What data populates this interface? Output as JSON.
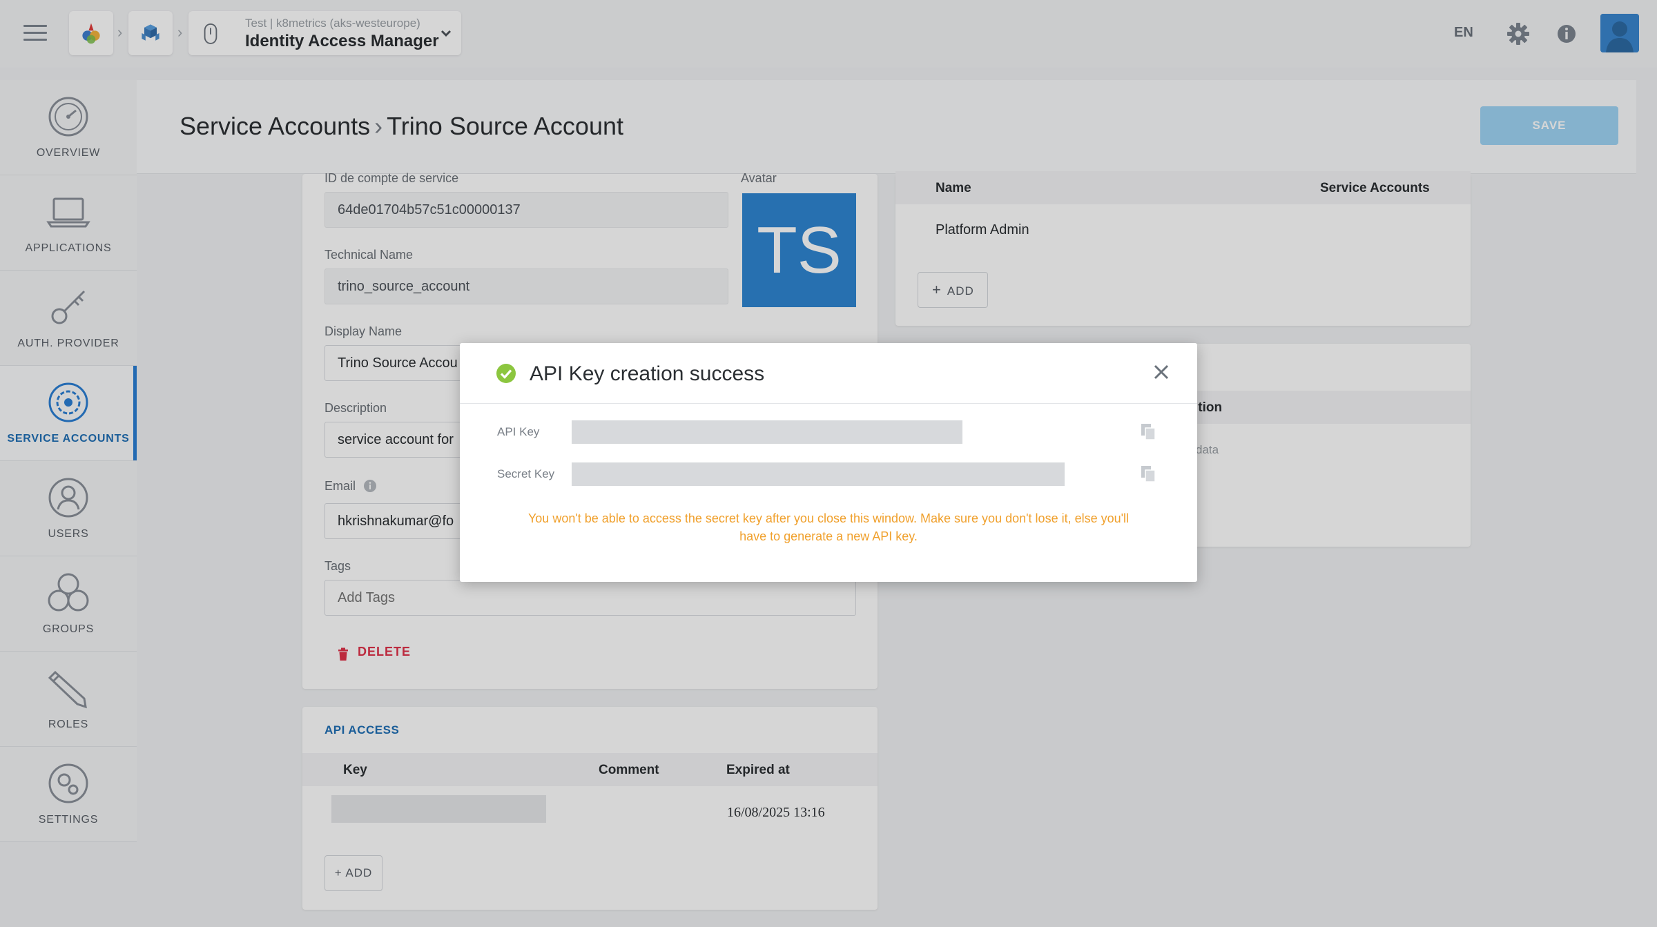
{
  "topbar": {
    "app_subtitle": "Test | k8metrics (aks-westeurope)",
    "app_title": "Identity Access Manager",
    "language": "EN"
  },
  "sidebar": {
    "items": [
      {
        "label": "OVERVIEW",
        "icon": "overview-icon"
      },
      {
        "label": "APPLICATIONS",
        "icon": "laptop-icon"
      },
      {
        "label": "AUTH. PROVIDER",
        "icon": "key-icon"
      },
      {
        "label": "SERVICE ACCOUNTS",
        "icon": "service-accounts-icon",
        "active": true
      },
      {
        "label": "USERS",
        "icon": "user-icon"
      },
      {
        "label": "GROUPS",
        "icon": "groups-icon"
      },
      {
        "label": "ROLES",
        "icon": "pencil-icon"
      },
      {
        "label": "SETTINGS",
        "icon": "settings-icon"
      }
    ]
  },
  "header": {
    "breadcrumb_parent": "Service Accounts",
    "breadcrumb_current": "Trino Source Account",
    "save_label": "SAVE"
  },
  "form": {
    "id_label": "ID de compte de service",
    "id_value": "64de01704b57c51c00000137",
    "avatar_label": "Avatar",
    "avatar_initials": "TS",
    "technical_name_label": "Technical Name",
    "technical_name_value": "trino_source_account",
    "display_name_label": "Display Name",
    "display_name_value": "Trino Source Accou",
    "description_label": "Description",
    "description_value": "service account for",
    "email_label": "Email",
    "email_value": "hkrishnakumar@fo",
    "tags_label": "Tags",
    "tags_placeholder": "Add Tags",
    "delete_label": "DELETE"
  },
  "groups_table": {
    "col_name": "Name",
    "col_service_accounts": "Service Accounts",
    "row_name": "Platform Admin",
    "add_label": "ADD"
  },
  "second_table": {
    "col_fragment": "ition",
    "empty_fragment": "data"
  },
  "api_access": {
    "title": "API ACCESS",
    "col_key": "Key",
    "col_comment": "Comment",
    "col_expired": "Expired at",
    "row_expired": "16/08/2025 13:16",
    "add_label": "+ ADD"
  },
  "modal": {
    "title": "API Key creation success",
    "api_key_label": "API Key",
    "secret_key_label": "Secret Key",
    "warning_line1": "You won't be able to access the secret key after you close this window. Make sure you don't lose it, else you'll",
    "warning_line2": "have to generate a new API key."
  },
  "colors": {
    "accent": "#2a7fd4",
    "success": "#8cc63f",
    "warning": "#f0a02c",
    "danger": "#e0334a",
    "save_disabled": "#9fd4f5"
  }
}
